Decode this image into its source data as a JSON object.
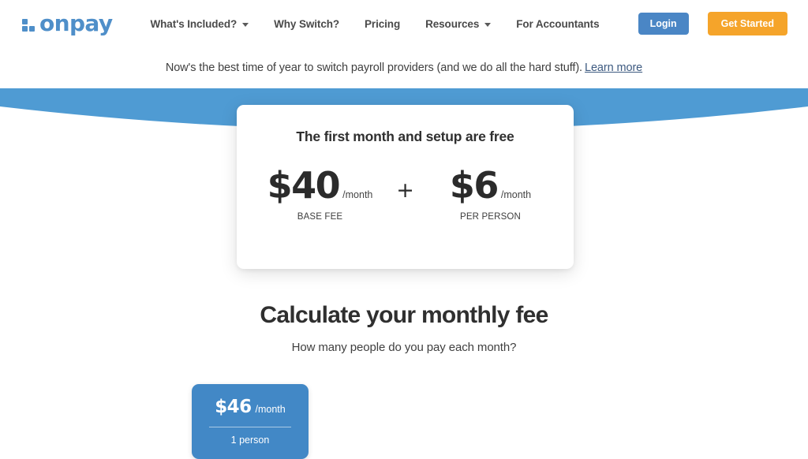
{
  "brand": {
    "name": "onpay",
    "color": "#4f8fc9"
  },
  "nav": {
    "items": [
      {
        "label": "What's Included?",
        "has_dropdown": true
      },
      {
        "label": "Why Switch?",
        "has_dropdown": false
      },
      {
        "label": "Pricing",
        "has_dropdown": false
      },
      {
        "label": "Resources",
        "has_dropdown": true
      },
      {
        "label": "For Accountants",
        "has_dropdown": false
      }
    ],
    "login_label": "Login",
    "login_color": "#4a86c5",
    "get_started_label": "Get Started",
    "get_started_color": "#f5a42a"
  },
  "banner": {
    "text": "Now's the best time of year to switch payroll providers (and we do all the hard stuff).",
    "link_label": "Learn more",
    "link_color": "#3d5a80"
  },
  "hero": {
    "curve_color": "#4f9bd3"
  },
  "price_card": {
    "heading": "The first month and setup are free",
    "base": {
      "amount": "$40",
      "period": "/month",
      "label": "BASE FEE"
    },
    "operator": "+",
    "per_person": {
      "amount": "$6",
      "period": "/month",
      "label": "PER PERSON"
    }
  },
  "calculator": {
    "title": "Calculate your monthly fee",
    "subtitle": "How many people do you pay each month?",
    "tooltip": {
      "amount": "$46",
      "period": "/month",
      "people": "1 person",
      "color": "#4288c6"
    }
  }
}
